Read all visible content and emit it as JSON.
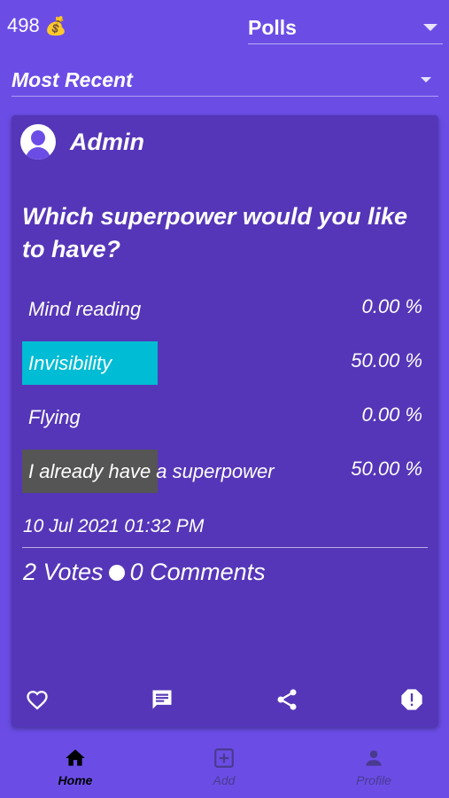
{
  "header": {
    "coins": "498",
    "coin_icon": "money-bag-icon",
    "category": "Polls",
    "sort": "Most Recent"
  },
  "poll": {
    "author": "Admin",
    "question": "Which superpower would you like to have?",
    "options": [
      {
        "label": "Mind reading",
        "percent": "0.00 %",
        "share": 0.0,
        "color": ""
      },
      {
        "label": "Invisibility",
        "percent": "50.00 %",
        "share": 0.5,
        "color": "#00bcd4"
      },
      {
        "label": "Flying",
        "percent": "0.00 %",
        "share": 0.0,
        "color": ""
      },
      {
        "label": "I already have a superpower",
        "percent": "50.00 %",
        "share": 0.5,
        "color": "#555555"
      }
    ],
    "timestamp": "10 Jul 2021 01:32 PM",
    "votes": "2 Votes",
    "comments": "0 Comments"
  },
  "nav": {
    "home": "Home",
    "add": "Add",
    "profile": "Profile"
  },
  "colors": {
    "background": "#6b4de6",
    "card": "#5536b8",
    "accent_cyan": "#00bcd4",
    "accent_grey": "#555555"
  }
}
